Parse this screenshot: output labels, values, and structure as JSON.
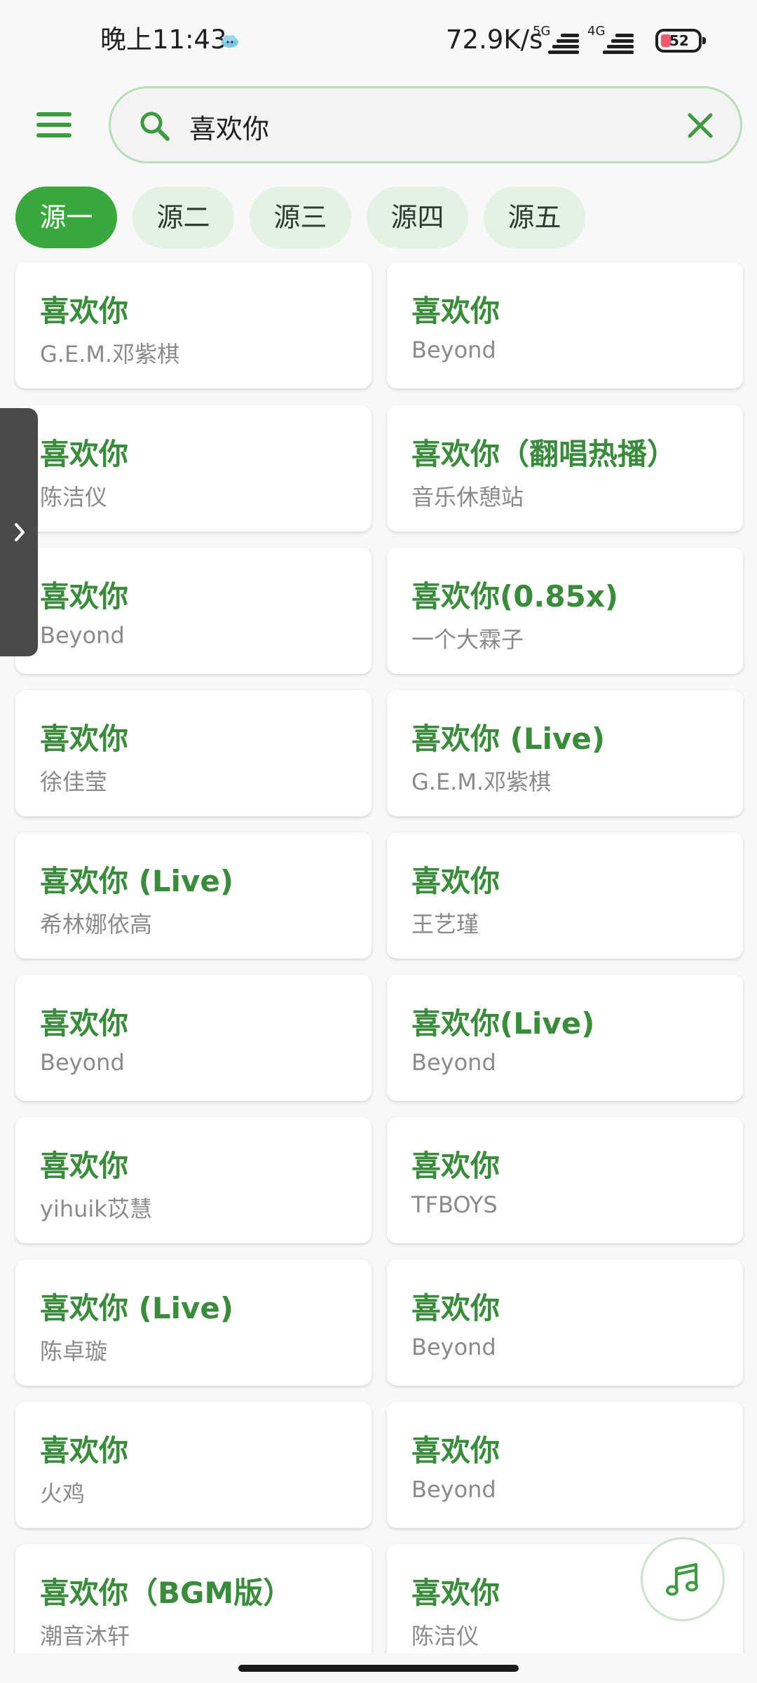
{
  "status_bar": {
    "time": "晚上11:43",
    "net_speed": "72.9K/s",
    "sim1_type": "5G",
    "sim2_type": "4G",
    "battery_level": "52"
  },
  "search": {
    "query": "喜欢你"
  },
  "sources": [
    "源一",
    "源二",
    "源三",
    "源四",
    "源五"
  ],
  "active_source": "源一",
  "results": [
    {
      "title": "喜欢你",
      "artist": "G.E.M.邓紫棋"
    },
    {
      "title": "喜欢你",
      "artist": "Beyond"
    },
    {
      "title": "喜欢你",
      "artist": "陈洁仪"
    },
    {
      "title": "喜欢你（翻唱热播）",
      "artist": "音乐休憩站"
    },
    {
      "title": "喜欢你",
      "artist": "Beyond"
    },
    {
      "title": "喜欢你(0.85x)",
      "artist": "一个大霖子"
    },
    {
      "title": "喜欢你",
      "artist": "徐佳莹"
    },
    {
      "title": "喜欢你 (Live)",
      "artist": "G.E.M.邓紫棋"
    },
    {
      "title": "喜欢你 (Live)",
      "artist": "希林娜依高"
    },
    {
      "title": "喜欢你",
      "artist": "王艺瑾"
    },
    {
      "title": "喜欢你",
      "artist": "Beyond"
    },
    {
      "title": "喜欢你(Live)",
      "artist": "Beyond"
    },
    {
      "title": "喜欢你",
      "artist": "yihuik苡慧"
    },
    {
      "title": "喜欢你",
      "artist": "TFBOYS"
    },
    {
      "title": "喜欢你 (Live)",
      "artist": "陈卓璇"
    },
    {
      "title": "喜欢你",
      "artist": "Beyond"
    },
    {
      "title": "喜欢你",
      "artist": "火鸡"
    },
    {
      "title": "喜欢你",
      "artist": "Beyond"
    },
    {
      "title": "喜欢你（BGM版）",
      "artist": "潮音沐轩"
    },
    {
      "title": "喜欢你",
      "artist": "陈洁仪"
    }
  ],
  "icons": {
    "menu": "menu-icon",
    "search": "search-icon",
    "clear": "close-icon",
    "side_panel": "chevron-right-icon",
    "player": "music-note-icon"
  },
  "colors": {
    "accent": "#3aa83d",
    "title_text": "#3a8b3c",
    "chip_bg": "#e3f2e3",
    "artist_text": "#8a8a8a"
  }
}
